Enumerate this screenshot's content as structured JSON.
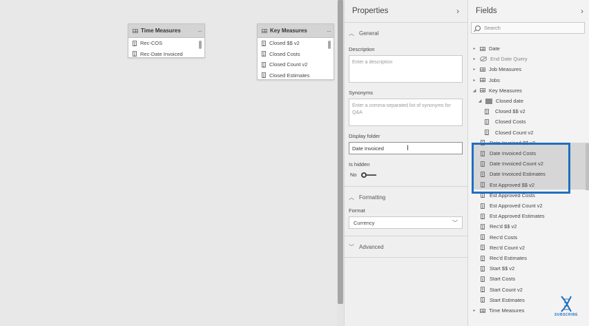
{
  "canvas": {
    "cards": [
      {
        "title": "Time Measures",
        "rows": [
          "Rec-COS",
          "Rec-Date Invoiced"
        ]
      },
      {
        "title": "Key Measures",
        "rows": [
          "Closed $$ v2",
          "Closed Costs",
          "Closed Count v2",
          "Closed Estimates"
        ]
      }
    ],
    "more_glyph": "···"
  },
  "properties": {
    "title": "Properties",
    "collapse_glyph": "›",
    "general_label": "General",
    "description_label": "Description",
    "description_placeholder": "Enter a description",
    "synonyms_label": "Synonyms",
    "synonyms_placeholder": "Enter a comma-separated list of synonyms for Q&A",
    "display_folder_label": "Display folder",
    "display_folder_value": "Date Invoiced",
    "is_hidden_label": "Is hidden",
    "is_hidden_value": "No",
    "formatting_label": "Formatting",
    "format_label": "Format",
    "format_value": "Currency",
    "advanced_label": "Advanced"
  },
  "fields": {
    "title": "Fields",
    "collapse_glyph": "›",
    "search_placeholder": "Search",
    "items": [
      {
        "label": "Date",
        "kind": "table",
        "level": 0
      },
      {
        "label": "End Date Query",
        "kind": "hidden",
        "level": 0
      },
      {
        "label": "Job Measures",
        "kind": "table",
        "level": 0
      },
      {
        "label": "Jobs",
        "kind": "table",
        "level": 0
      },
      {
        "label": "Key Measures",
        "kind": "table-open",
        "level": 0
      },
      {
        "label": "Closed date",
        "kind": "folder",
        "level": 1
      },
      {
        "label": "Closed $$ v2",
        "kind": "measure",
        "level": 2
      },
      {
        "label": "Closed Costs",
        "kind": "measure",
        "level": 2
      },
      {
        "label": "Closed Count v2",
        "kind": "measure",
        "level": 2
      },
      {
        "label": "Date Invoiced $$ v2",
        "kind": "measure",
        "level": 1
      },
      {
        "label": "Date Invoiced Costs",
        "kind": "measure",
        "level": 1
      },
      {
        "label": "Date Invoiced Count v2",
        "kind": "measure",
        "level": 1
      },
      {
        "label": "Date Invoiced Estimates",
        "kind": "measure",
        "level": 1
      },
      {
        "label": "Est Approved $$ v2",
        "kind": "measure",
        "level": 1
      },
      {
        "label": "Est Approved Costs",
        "kind": "measure",
        "level": 1
      },
      {
        "label": "Est Approved Count v2",
        "kind": "measure",
        "level": 1
      },
      {
        "label": "Est Approved Estimates",
        "kind": "measure",
        "level": 1
      },
      {
        "label": "Rec'd $$ v2",
        "kind": "measure",
        "level": 1
      },
      {
        "label": "Rec'd Costs",
        "kind": "measure",
        "level": 1
      },
      {
        "label": "Rec'd Count v2",
        "kind": "measure",
        "level": 1
      },
      {
        "label": "Rec'd Estimates",
        "kind": "measure",
        "level": 1
      },
      {
        "label": "Start $$ v2",
        "kind": "measure",
        "level": 1
      },
      {
        "label": "Start Costs",
        "kind": "measure",
        "level": 1
      },
      {
        "label": "Start Count v2",
        "kind": "measure",
        "level": 1
      },
      {
        "label": "Start Estimates",
        "kind": "measure",
        "level": 1
      },
      {
        "label": "Time Measures",
        "kind": "table",
        "level": 0
      }
    ]
  },
  "logo_text": "SUBSCRIBE",
  "colors": {
    "highlight": "#1f6fbf",
    "pane_bg": "#efefef"
  }
}
